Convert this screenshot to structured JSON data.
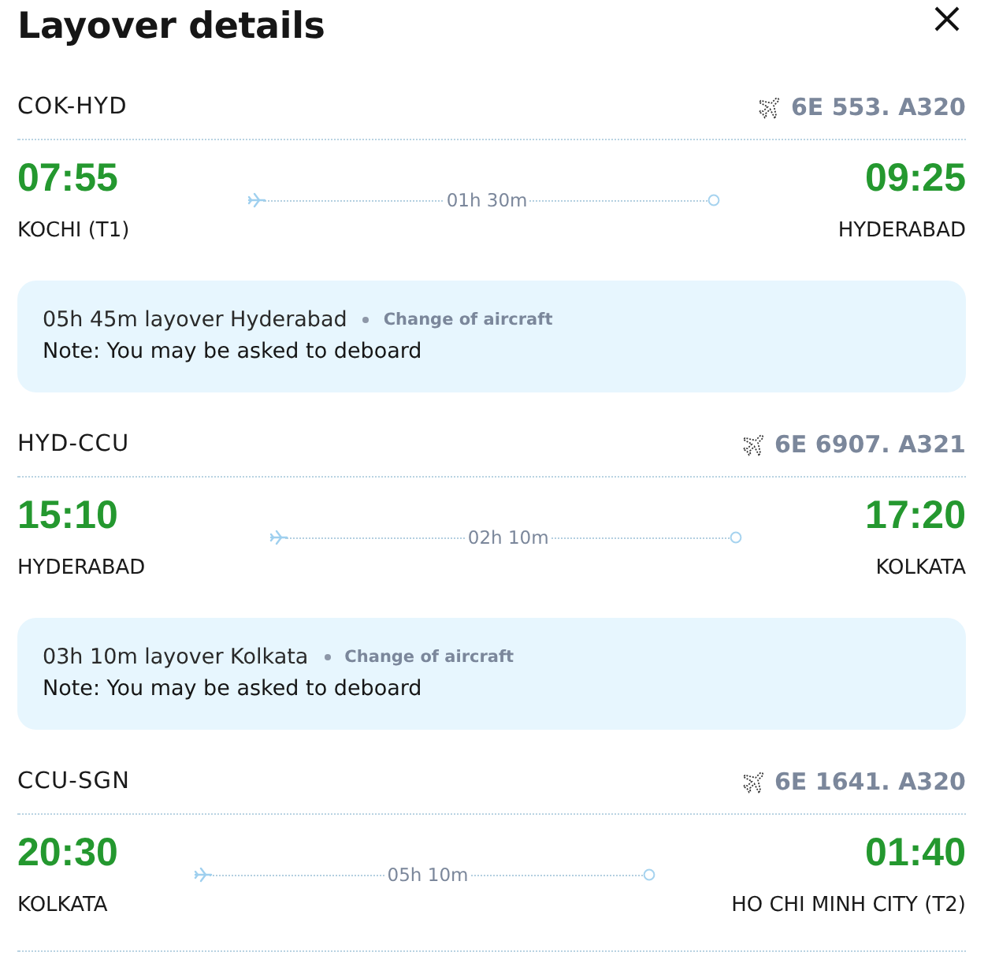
{
  "title": "Layover details",
  "legs": [
    {
      "kind": "flight",
      "route": "COK-HYD",
      "flight": "6E 553. A320",
      "departure": {
        "time": "07:55",
        "city": "KOCHI (T1)"
      },
      "arrival": {
        "time": "09:25",
        "city": "HYDERABAD"
      },
      "duration": "01h 30m"
    },
    {
      "kind": "layover",
      "text": "05h 45m layover Hyderabad",
      "tag": "Change of aircraft",
      "note": "Note: You may be asked to deboard"
    },
    {
      "kind": "flight",
      "route": "HYD-CCU",
      "flight": "6E 6907. A321",
      "departure": {
        "time": "15:10",
        "city": "HYDERABAD"
      },
      "arrival": {
        "time": "17:20",
        "city": "KOLKATA"
      },
      "duration": "02h 10m"
    },
    {
      "kind": "layover",
      "text": "03h 10m layover Kolkata",
      "tag": "Change of aircraft",
      "note": "Note: You may be asked to deboard"
    },
    {
      "kind": "flight",
      "route": "CCU-SGN",
      "flight": "6E 1641. A320",
      "departure": {
        "time": "20:30",
        "city": "KOLKATA"
      },
      "arrival": {
        "time": "01:40",
        "city": "HO CHI MINH CITY (T2)"
      },
      "duration": "05h 10m"
    }
  ]
}
